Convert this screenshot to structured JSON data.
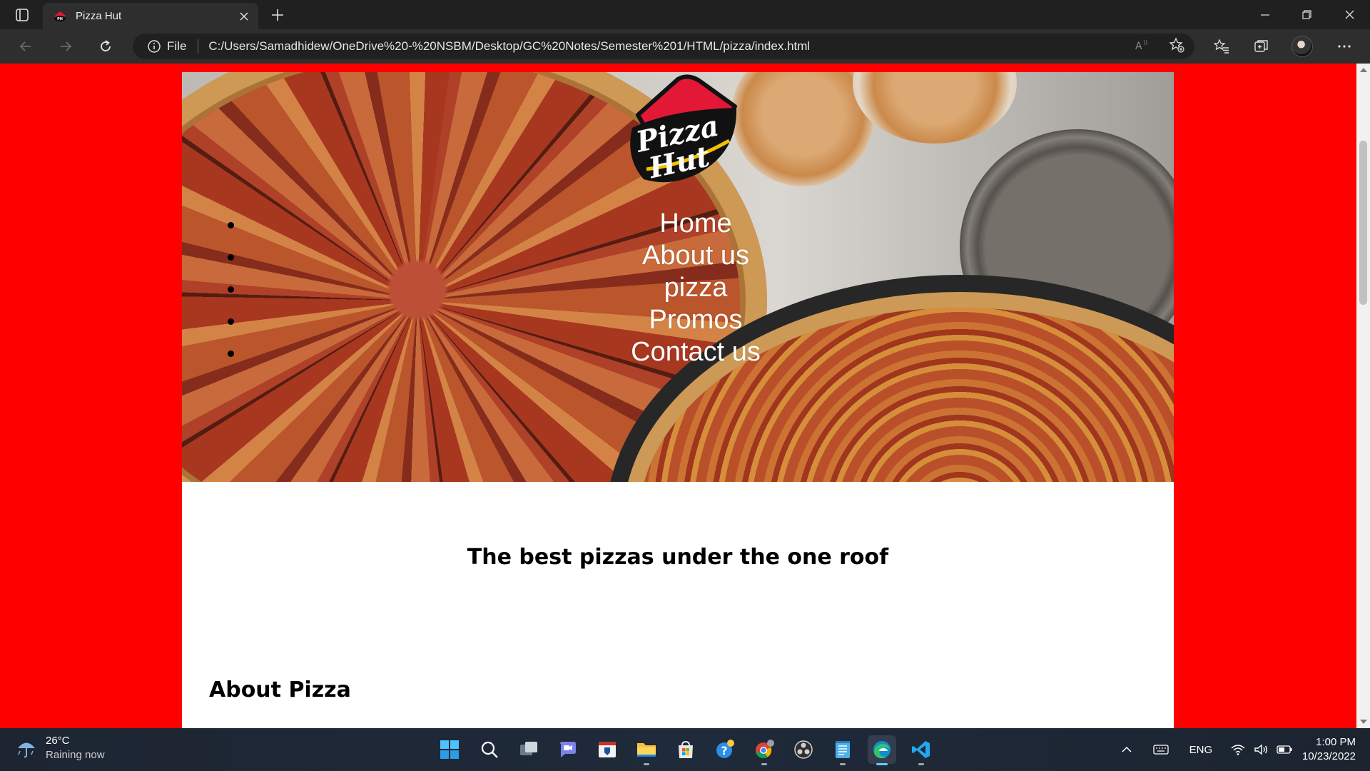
{
  "browser": {
    "tab_title": "Pizza Hut",
    "site_label": "File",
    "url": "C:/Users/Samadhidew/OneDrive%20-%20NSBM/Desktop/GC%20Notes/Semester%201/HTML/pizza/index.html"
  },
  "page": {
    "background_color": "#ff0000",
    "nav": [
      "Home",
      "About us",
      "pizza",
      "Promos",
      "Contact us"
    ],
    "tagline": "The best pizzas under the one roof",
    "about_heading": "About Pizza",
    "logo_text_1": "Pizza",
    "logo_text_2": "Hut"
  },
  "taskbar": {
    "temperature": "26°C",
    "weather": "Raining now",
    "language": "ENG",
    "time": "1:00 PM",
    "date": "10/23/2022",
    "apps": [
      "start-icon",
      "search-icon",
      "task-view-icon",
      "teams-chat-icon",
      "app-icon",
      "file-explorer-icon",
      "microsoft-store-icon",
      "help-icon",
      "chrome-icon",
      "obs-icon",
      "notepad-icon",
      "edge-icon",
      "vscode-icon"
    ]
  }
}
